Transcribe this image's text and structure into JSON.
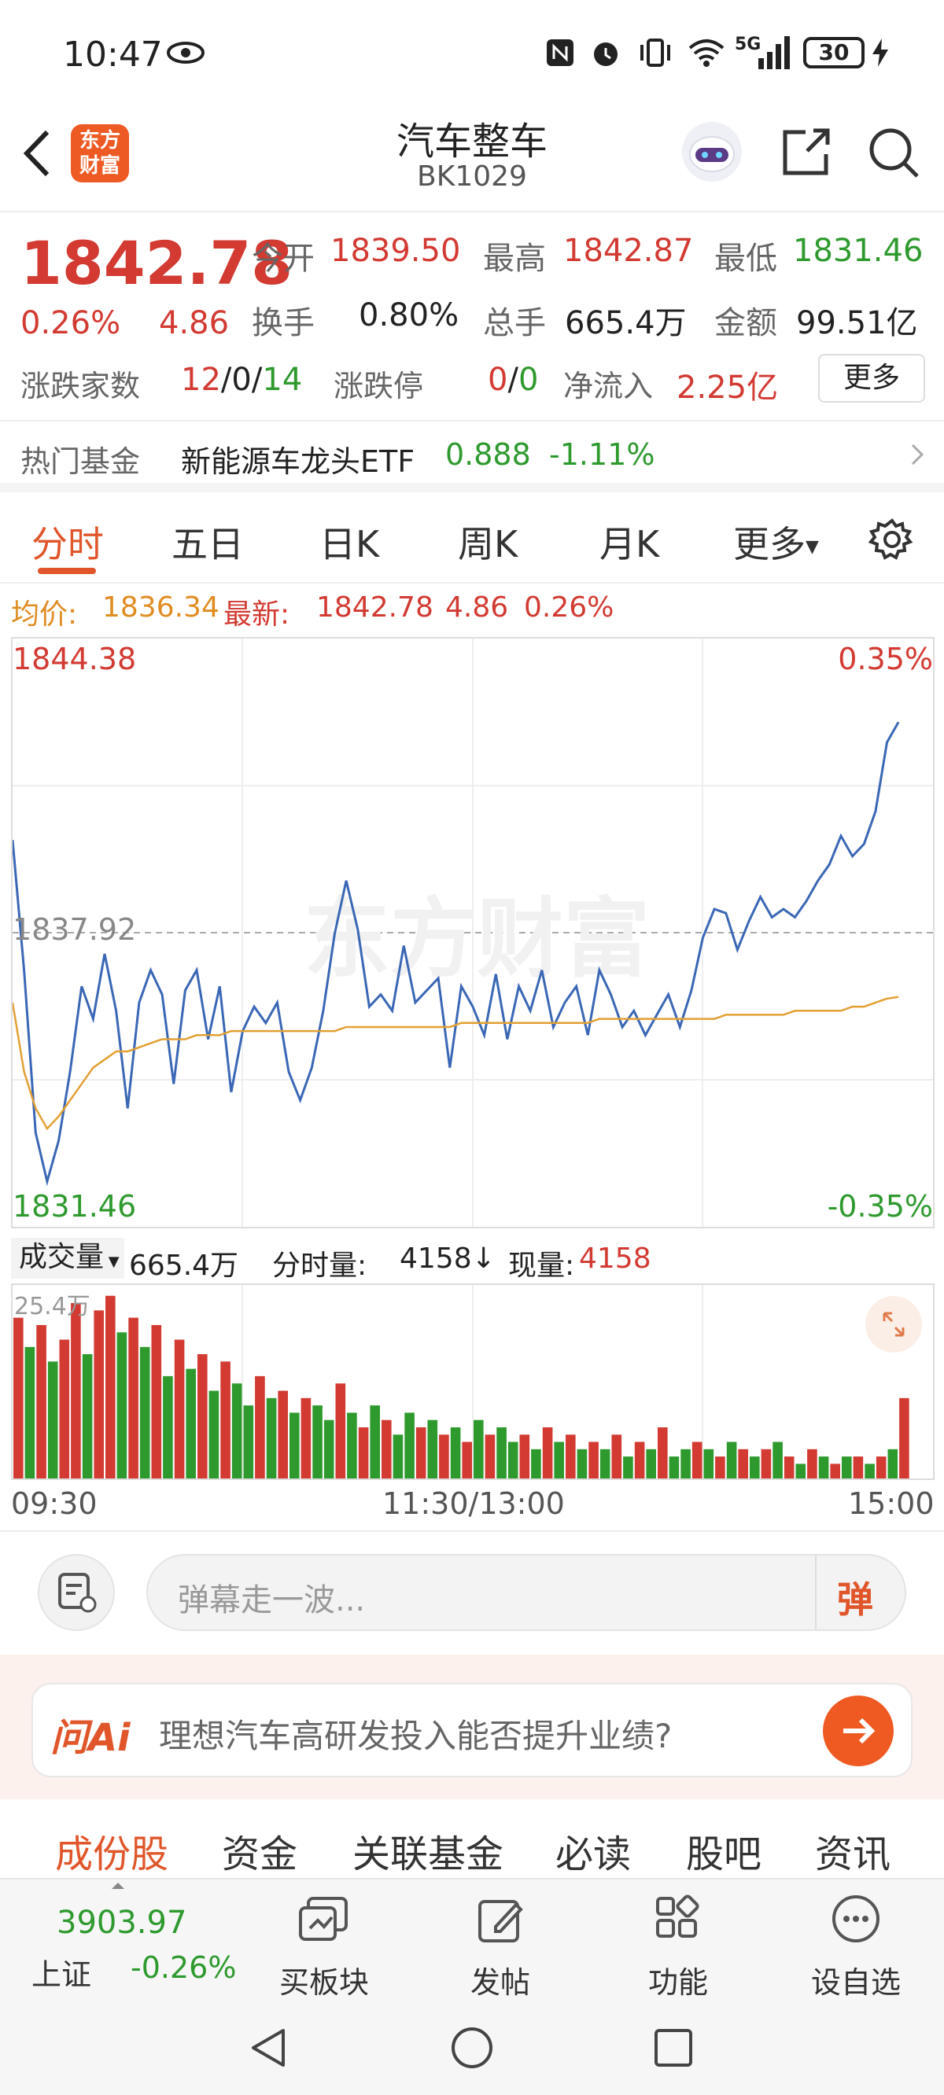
{
  "status_bar": {
    "time": "10:47",
    "battery": "30",
    "network": "5G"
  },
  "header": {
    "title": "汽车整车",
    "code": "BK1029",
    "logo_text": "东方\n财富"
  },
  "quote": {
    "price": "1842.78",
    "change_pct": "0.26%",
    "change": "4.86",
    "open_label": "今开",
    "open": "1839.50",
    "high_label": "最高",
    "high": "1842.87",
    "low_label": "最低",
    "low": "1831.46",
    "turnover_label": "换手",
    "turnover": "0.80%",
    "volume_label": "总手",
    "volume": "665.4万",
    "amount_label": "金额",
    "amount": "99.51亿",
    "updown_label": "涨跌家数",
    "up_count": "12",
    "flat_count": "0",
    "down_count": "14",
    "limit_label": "涨跌停",
    "limit_up": "0",
    "limit_down": "0",
    "inflow_label": "净流入",
    "inflow": "2.25亿",
    "more_button": "更多"
  },
  "hot_fund": {
    "label": "热门基金",
    "name": "新能源车龙头ETF",
    "price": "0.888",
    "change": "-1.11%"
  },
  "tabs": [
    "分时",
    "五日",
    "日K",
    "周K",
    "月K",
    "更多"
  ],
  "avg_row": {
    "avg_label": "均价:",
    "avg": "1836.34",
    "latest_label": "最新:",
    "latest": "1842.78",
    "change": "4.86",
    "change_pct": "0.26%"
  },
  "chart_data": {
    "type": "line",
    "title": "",
    "y_labels": {
      "top": "1844.38",
      "mid": "1837.92",
      "bottom": "1831.46",
      "top_pct": "0.35%",
      "bottom_pct": "-0.35%"
    },
    "ylim": [
      1831.46,
      1844.38
    ],
    "x_labels": [
      "09:30",
      "11:30/13:00",
      "15:00"
    ],
    "total_minutes": 240,
    "watermark": "东方财富",
    "series": [
      {
        "color": "#3a67b5",
        "values": [
          1840.2,
          1837.0,
          1833.0,
          1831.8,
          1832.8,
          1834.5,
          1836.6,
          1835.8,
          1837.4,
          1836.0,
          1833.6,
          1836.2,
          1837.0,
          1836.4,
          1834.2,
          1836.5,
          1837.0,
          1835.3,
          1836.6,
          1834.0,
          1835.5,
          1836.1,
          1835.7,
          1836.2,
          1834.5,
          1833.8,
          1834.6,
          1836.0,
          1837.9,
          1839.2,
          1838.0,
          1836.1,
          1836.4,
          1836.0,
          1837.6,
          1836.2,
          1836.5,
          1836.8,
          1834.6,
          1836.6,
          1836.1,
          1835.4,
          1836.9,
          1835.3,
          1836.6,
          1836.0,
          1837.0,
          1835.6,
          1836.2,
          1836.6,
          1835.4,
          1837.0,
          1836.4,
          1835.6,
          1836.0,
          1835.4,
          1835.9,
          1836.4,
          1835.6,
          1836.5,
          1837.8,
          1838.5,
          1838.4,
          1837.5,
          1838.2,
          1838.8,
          1838.3,
          1838.5,
          1838.3,
          1838.7,
          1839.2,
          1839.6,
          1840.3,
          1839.8,
          1840.1,
          1840.9,
          1842.6,
          1843.1
        ]
      },
      {
        "color": "#e2a033",
        "values": [
          1836.2,
          1834.5,
          1833.6,
          1833.1,
          1833.4,
          1833.8,
          1834.2,
          1834.6,
          1834.8,
          1835.0,
          1835.0,
          1835.1,
          1835.2,
          1835.3,
          1835.3,
          1835.3,
          1835.4,
          1835.4,
          1835.4,
          1835.5,
          1835.5,
          1835.5,
          1835.5,
          1835.5,
          1835.5,
          1835.5,
          1835.5,
          1835.5,
          1835.5,
          1835.6,
          1835.6,
          1835.6,
          1835.6,
          1835.6,
          1835.6,
          1835.6,
          1835.6,
          1835.6,
          1835.6,
          1835.7,
          1835.7,
          1835.7,
          1835.7,
          1835.7,
          1835.7,
          1835.7,
          1835.7,
          1835.7,
          1835.7,
          1835.7,
          1835.7,
          1835.8,
          1835.8,
          1835.8,
          1835.8,
          1835.8,
          1835.8,
          1835.8,
          1835.8,
          1835.8,
          1835.8,
          1835.8,
          1835.9,
          1835.9,
          1835.9,
          1835.9,
          1835.9,
          1835.9,
          1836.0,
          1836.0,
          1836.0,
          1836.0,
          1836.0,
          1836.1,
          1836.1,
          1836.2,
          1836.3,
          1836.34
        ]
      }
    ]
  },
  "volume_header": {
    "selector": "成交量",
    "total": "665.4万",
    "minute_label": "分时量:",
    "minute_value": "4158↓",
    "current_label": "现量:",
    "current_value": "4158",
    "scale_label": "25.4万"
  },
  "volume_data": {
    "type": "bar",
    "ylim": [
      0,
      25.4
    ],
    "values": [
      22,
      18,
      21,
      16,
      19,
      24,
      17,
      23,
      25,
      20,
      22,
      18,
      21,
      14,
      19,
      15,
      17,
      12,
      16,
      13,
      10,
      14,
      11,
      12,
      9,
      11,
      10,
      8,
      13,
      9,
      7,
      10,
      8,
      6,
      9,
      7,
      8,
      6,
      7,
      5,
      8,
      6,
      7,
      5,
      6,
      4,
      7,
      5,
      6,
      4,
      5,
      4,
      6,
      3,
      5,
      4,
      7,
      3,
      4,
      5,
      4,
      3,
      5,
      4,
      3,
      4,
      5,
      3,
      2,
      4,
      3,
      2,
      3,
      3,
      2,
      3,
      4,
      11
    ],
    "colors": [
      "r",
      "g",
      "r",
      "g",
      "r",
      "r",
      "g",
      "r",
      "r",
      "g",
      "r",
      "g",
      "r",
      "g",
      "r",
      "g",
      "r",
      "g",
      "r",
      "g",
      "g",
      "r",
      "g",
      "r",
      "g",
      "r",
      "g",
      "g",
      "r",
      "g",
      "r",
      "g",
      "r",
      "g",
      "g",
      "r",
      "g",
      "r",
      "g",
      "r",
      "g",
      "r",
      "g",
      "g",
      "r",
      "g",
      "r",
      "g",
      "r",
      "g",
      "r",
      "g",
      "r",
      "g",
      "r",
      "g",
      "r",
      "g",
      "g",
      "r",
      "g",
      "r",
      "g",
      "r",
      "g",
      "r",
      "g",
      "r",
      "g",
      "r",
      "g",
      "r",
      "g",
      "r",
      "g",
      "r",
      "g",
      "r"
    ]
  },
  "comment": {
    "placeholder": "弹幕走一波...",
    "danmu_icon": "弹"
  },
  "ai": {
    "logo": "问Ai",
    "question": "理想汽车高研发投入能否提升业绩?"
  },
  "sub_tabs": [
    "成份股",
    "资金",
    "关联基金",
    "必读",
    "股吧",
    "资讯"
  ],
  "bottom_bar": {
    "index_value": "3903.97",
    "index_name": "上证",
    "index_change": "-0.26%",
    "buy_label": "买板块",
    "post_label": "发帖",
    "func_label": "功能",
    "fav_label": "设自选"
  },
  "colors": {
    "red": "#d23a32",
    "green": "#2e9a2e",
    "orange": "#e08c22",
    "blue": "#3a67b5"
  }
}
